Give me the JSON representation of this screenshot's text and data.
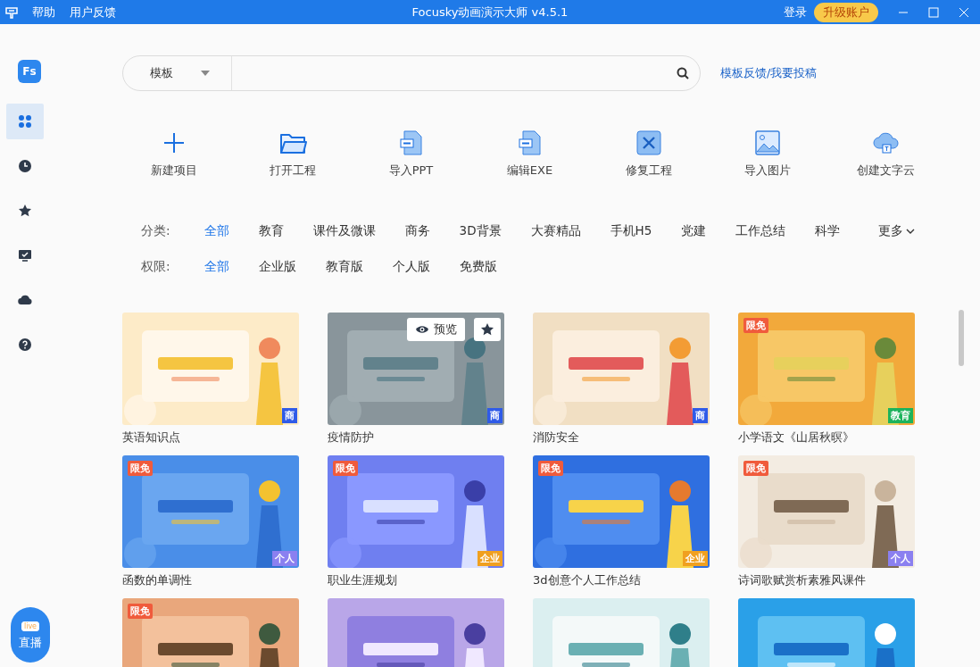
{
  "title_bar": {
    "menu": [
      {
        "label": "帮助"
      },
      {
        "label": "用户反馈"
      }
    ],
    "title": "Focusky动画演示大师 v4.5.1",
    "login": "登录",
    "upgrade": "升级账户"
  },
  "sidebar": {
    "logo": "Fs",
    "items": [
      {
        "selected": true
      },
      {
        "selected": false
      },
      {
        "selected": false
      },
      {
        "selected": false
      },
      {
        "selected": false
      },
      {
        "selected": false
      }
    ],
    "live_button": {
      "icon_text": "live",
      "label": "直播"
    }
  },
  "search": {
    "scope": "模板",
    "link": "模板反馈/我要投稿"
  },
  "actions": [
    {
      "label": "新建项目"
    },
    {
      "label": "打开工程"
    },
    {
      "label": "导入PPT"
    },
    {
      "label": "编辑EXE"
    },
    {
      "label": "修复工程"
    },
    {
      "label": "导入图片"
    },
    {
      "label": "创建文字云"
    }
  ],
  "filters": [
    {
      "label": "分类:",
      "options": [
        {
          "label": "全部",
          "selected": true
        },
        {
          "label": "教育",
          "selected": false
        },
        {
          "label": "课件及微课",
          "selected": false
        },
        {
          "label": "商务",
          "selected": false
        },
        {
          "label": "3D背景",
          "selected": false
        },
        {
          "label": "大赛精品",
          "selected": false
        },
        {
          "label": "手机H5",
          "selected": false
        },
        {
          "label": "党建",
          "selected": false
        },
        {
          "label": "工作总结",
          "selected": false
        },
        {
          "label": "科学",
          "selected": false
        }
      ],
      "more": "更多"
    },
    {
      "label": "权限:",
      "options": [
        {
          "label": "全部",
          "selected": true
        },
        {
          "label": "企业版",
          "selected": false
        },
        {
          "label": "教育版",
          "selected": false
        },
        {
          "label": "个人版",
          "selected": false
        },
        {
          "label": "免费版",
          "selected": false
        }
      ]
    }
  ],
  "templates": [
    {
      "title": "英语知识点",
      "tag": {
        "text": "商",
        "color": "#2f5be8"
      },
      "hovered": false
    },
    {
      "title": "疫情防护",
      "tag": {
        "text": "商",
        "color": "#2f5be8"
      },
      "hovered": true,
      "preview": "预览"
    },
    {
      "title": "消防安全",
      "tag": {
        "text": "商",
        "color": "#2f5be8"
      },
      "hovered": false
    },
    {
      "title": "小学语文《山居秋暝》",
      "promo": "限免",
      "tag": {
        "text": "教育",
        "color": "#1db35c"
      },
      "hovered": false
    },
    {
      "title": "函数的单调性",
      "promo": "限免",
      "tag": {
        "text": "个人",
        "color": "#8b80f0"
      },
      "hovered": false
    },
    {
      "title": "职业生涯规划",
      "promo": "限免",
      "tag": {
        "text": "企业",
        "color": "#f0a020"
      },
      "hovered": false
    },
    {
      "title": "3d创意个人工作总结",
      "promo": "限免",
      "tag": {
        "text": "企业",
        "color": "#f0a020"
      },
      "hovered": false
    },
    {
      "title": "诗词歌赋赏析素雅风课件",
      "promo": "限免",
      "tag": {
        "text": "个人",
        "color": "#8b80f0"
      },
      "hovered": false
    },
    {
      "promo": "限免",
      "hovered": false
    },
    {
      "hovered": false
    },
    {
      "hovered": false
    },
    {
      "hovered": false
    }
  ]
}
